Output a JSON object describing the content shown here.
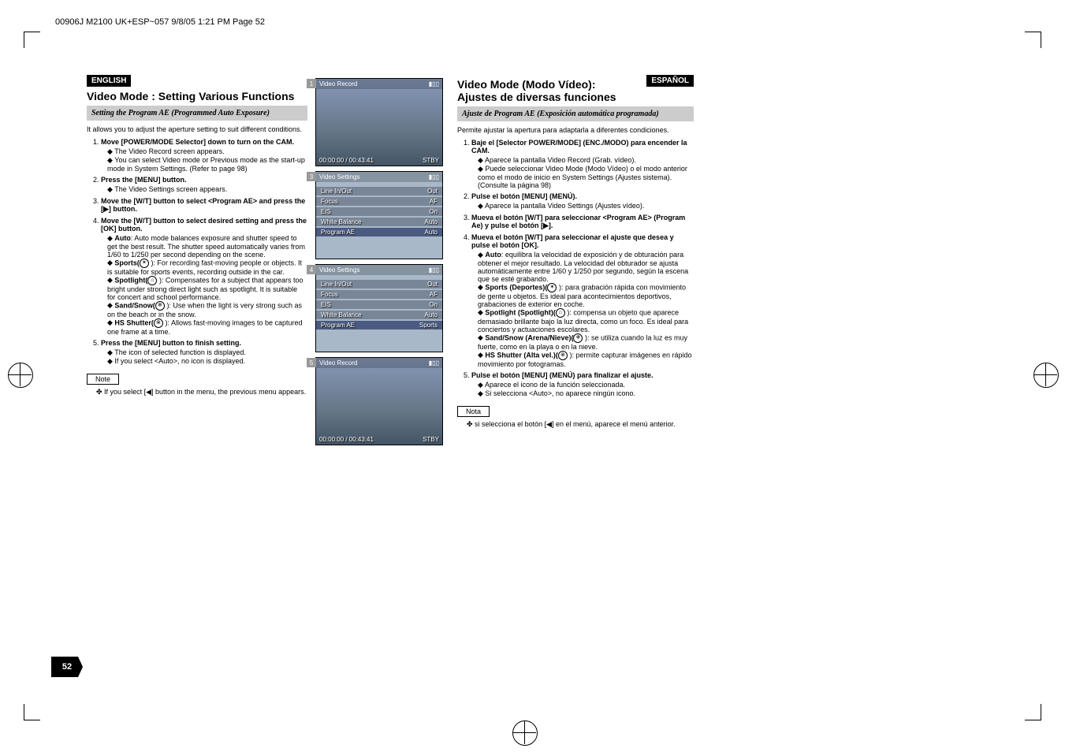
{
  "header_line": "00906J M2100 UK+ESP~057  9/8/05 1:21 PM  Page 52",
  "page_number": "52",
  "english": {
    "lang": "ENGLISH",
    "title": "Video Mode : Setting Various Functions",
    "section": "Setting the Program AE (Programmed Auto Exposure)",
    "intro": "It allows you to adjust the aperture setting to suit different conditions.",
    "steps": {
      "s1_title": "Move [POWER/MODE Selector] down to turn on the CAM.",
      "s1_sub1": "The Video Record screen appears.",
      "s1_sub2": "You can select Video mode or Previous mode as the start-up mode in System Settings. (Refer to page 98)",
      "s2_title": "Press the [MENU] button.",
      "s2_sub1": "The Video Settings screen appears.",
      "s3_title": "Move the [W/T] button to select <Program AE> and press the [▶] button.",
      "s4_title": "Move the [W/T] button to select desired setting and press the [OK] button.",
      "auto_name": "Auto",
      "auto_desc": ": Auto mode balances exposure and shutter speed to get the best result. The shutter speed automatically varies from 1/60 to 1/250 per second depending on the scene.",
      "sports_name": "Sports(",
      "sports_desc": "): For recording fast-moving people or objects. It is suitable for sports events, recording outside in the car.",
      "spotlight_name": "Spotlight(",
      "spotlight_desc": "): Compensates for a subject that appears too bright under strong direct light such as spotlight. It is suitable for concert and school performance.",
      "sandsnow_name": "Sand/Snow(",
      "sandsnow_desc": "): Use when the light is very strong such as on the beach or in the snow.",
      "hs_name": "HS Shutter(",
      "hs_desc": "): Allows fast-moving images to be captured one frame at a time.",
      "s5_title": "Press the [MENU] button to finish setting.",
      "s5_sub1": "The icon of selected function is displayed.",
      "s5_sub2": "If you select <Auto>, no icon is displayed.",
      "note_label": "Note",
      "note_text": "If you select [◀] button in the menu, the previous menu appears."
    }
  },
  "spanish": {
    "lang": "ESPAÑOL",
    "title1": "Video Mode (Modo Vídeo):",
    "title2": "Ajustes de diversas funciones",
    "section": "Ajuste de Program AE (Exposición automática programada)",
    "intro": "Permite ajustar la apertura para adaptarla a diferentes condiciones.",
    "steps": {
      "s1_title": "Baje el [Selector POWER/MODE] (ENC./MODO) para encender la CAM.",
      "s1_sub1": "Aparece la pantalla Video Record (Grab. vídeo).",
      "s1_sub2": "Puede seleccionar Video Mode (Modo Vídeo) o el modo anterior como el modo de inicio en System Settings (Ajustes sistema). (Consulte la página 98)",
      "s2_title": "Pulse el botón [MENU] (MENÚ).",
      "s2_sub1": "Aparece la pantalla Video Settings (Ajustes vídeo).",
      "s3_title": "Mueva el botón [W/T] para seleccionar <Program AE> (Program Ae) y pulse el botón [▶].",
      "s4_title": "Mueva el botón [W/T] para seleccionar el ajuste que desea y pulse el botón [OK].",
      "auto_name": "Auto",
      "auto_desc": ": equilibra la velocidad de exposición y de obturación  para obtener el mejor resultado. La velocidad del obturador se ajusta automáticamente entre 1/60 y 1/250 por segundo, según la escena que se esté grabando.",
      "sports_name": "Sports (Deportes)(",
      "sports_desc": "): para grabación rápida con movimiento de gente u objetos. Es ideal para acontecimientos deportivos, grabaciones de exterior en coche.",
      "spotlight_name": "Spotlight (Spotlight)(",
      "spotlight_desc": "): compensa un objeto que aparece demasiado brillante bajo la luz directa, como un foco. Es ideal para conciertos y actuaciones escolares.",
      "sandsnow_name": "Sand/Snow (Arena/Nieve)(",
      "sandsnow_desc": "): se utiliza cuando la luz es muy fuerte, como en la playa o en la nieve.",
      "hs_name": "HS Shutter (Alta vel.)(",
      "hs_desc": "): permite capturar imágenes en rápido movimiento por fotogramas.",
      "s5_title": "Pulse el botón [MENU] (MENÚ) para finalizar el ajuste.",
      "s5_sub1": "Aparece el icono de la función seleccionada.",
      "s5_sub2": "Si selecciona <Auto>, no aparece ningún icono.",
      "note_label": "Nota",
      "note_text": "si selecciona el botón [◀] en el menú, aparece el menú anterior."
    }
  },
  "screenshots": {
    "s1": {
      "num": "1",
      "title": "Video Record",
      "time": "00:00:00 / 00:43:41",
      "status": "STBY"
    },
    "s3": {
      "num": "3",
      "title": "Video Settings",
      "r1k": "Line In/Out",
      "r1v": "Out",
      "r2k": "Focus",
      "r2v": "AF",
      "r3k": "EIS",
      "r3v": "On",
      "r4k": "White Balance",
      "r4v": "Auto",
      "r5k": "Program AE",
      "r5v": "Auto"
    },
    "s4": {
      "num": "4",
      "title": "Video Settings",
      "r1k": "Line In/Out",
      "r1v": "Out",
      "r2k": "Focus",
      "r2v": "AF",
      "r3k": "EIS",
      "r3v": "On",
      "r4k": "White Balance",
      "r4v": "Auto",
      "r5k": "Program AE",
      "r5v": "Sports"
    },
    "s5": {
      "num": "5",
      "title": "Video Record",
      "time": "00:00:00 / 00:43:41",
      "status": "STBY"
    }
  }
}
